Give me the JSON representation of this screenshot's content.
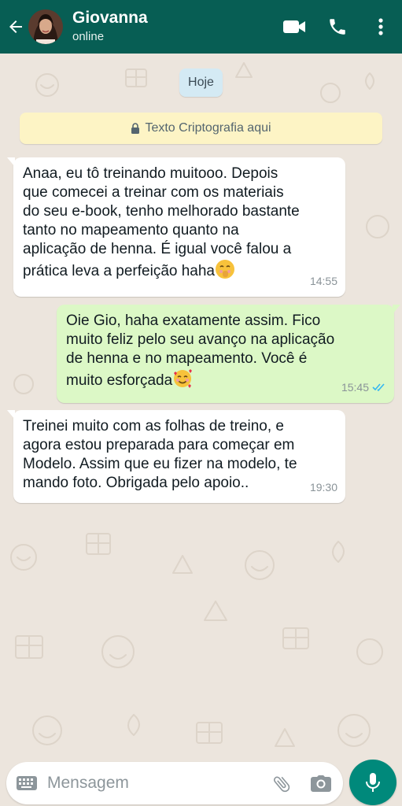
{
  "header": {
    "back_icon": "arrow-left-icon",
    "contact_name": "Giovanna",
    "status": "online",
    "video_icon": "video-camera-icon",
    "call_icon": "phone-icon",
    "menu_icon": "more-vertical-icon"
  },
  "chat": {
    "date_label": "Hoje",
    "encryption_notice": "Texto Criptografia aqui",
    "messages": [
      {
        "direction": "incoming",
        "text": "Anaa, eu tô treinando muitooo. Depois\nque comecei a treinar com os materiais\ndo seu e-book, tenho melhorado bastante\ntanto no mapeamento quanto na\naplicação de henna. É igual você falou a\nprática leva a perfeição haha",
        "emoji": "shushing-face-emoji",
        "time": "14:55"
      },
      {
        "direction": "outgoing",
        "text": "Oie Gio, haha exatamente assim. Fico\nmuito feliz pelo seu avanço na aplicação\nde henna e no mapeamento. Você é\nmuito esforçada",
        "emoji": "smiling-face-with-hearts-emoji",
        "time": "15:45",
        "status": "read"
      },
      {
        "direction": "incoming",
        "text": "Treinei muito com as folhas de treino, e\nagora estou preparada para começar em\nModelo. Assim que eu fizer na modelo, te\nmando foto. Obrigada pelo apoio..",
        "time": "19:30"
      }
    ]
  },
  "composer": {
    "placeholder": "Mensagem",
    "value": "",
    "keyboard_icon": "keyboard-icon",
    "attach_icon": "paperclip-icon",
    "camera_icon": "camera-icon",
    "mic_icon": "microphone-icon"
  },
  "colors": {
    "header": "#075e54",
    "wallpaper": "#ece5dd",
    "incoming_bubble": "#ffffff",
    "outgoing_bubble": "#dcf8c6",
    "date_chip": "#d4eaf4",
    "encryption_bg": "#fdf4c5",
    "read_ticks": "#34b7f1",
    "mic_button": "#00897b"
  }
}
